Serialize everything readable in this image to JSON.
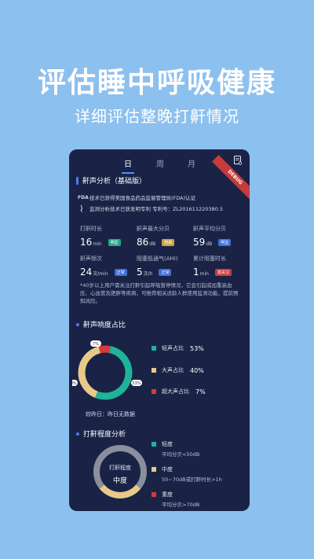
{
  "hero": {
    "title": "评估睡中呼吸健康",
    "subtitle": "详细评估整晚打鼾情况"
  },
  "tabs": [
    "日",
    "周",
    "月"
  ],
  "debug_label": "DEBUG",
  "analysis": {
    "title": "鼾声分析（基础版）",
    "fda_icon": "FDA",
    "fda_text": "技术已获得美国食品药品监督管理局(FDA)认证",
    "patent_text": "监测分析技术已获发明专利 专利号：ZL201611220380.5",
    "metrics": [
      {
        "label": "打鼾时长",
        "value": "16",
        "unit": "min",
        "badge": "明显",
        "badge_color": "#24a58a"
      },
      {
        "label": "鼾声最大分贝",
        "value": "86",
        "unit": "dB",
        "badge": "较高",
        "badge_color": "#c9a24e"
      },
      {
        "label": "鼾声平均分贝",
        "value": "59",
        "unit": "dB",
        "badge": "明显",
        "badge_color": "#3f6fd8"
      },
      {
        "label": "鼾声频次",
        "value": "24",
        "unit": "次/min",
        "badge": "正常",
        "badge_color": "#3f6fd8"
      },
      {
        "label": "阻塞低通气(AHI)",
        "value": "5",
        "unit": "次/h",
        "badge": "正常",
        "badge_color": "#3f6fd8"
      },
      {
        "label": "累计阻塞时长",
        "value": "1",
        "unit": "min",
        "badge": "需关注",
        "badge_color": "#cf3b3b"
      }
    ],
    "note": "*40岁以上用户需关注打鼾引起呼吸暂停情况，它会引起或加重高血压、心血管及肥胖等疾病，可推荐相关适龄人群使用监测功能，提前预知风险。"
  },
  "loudness": {
    "title": "鼾声响度占比",
    "compare": "较昨日：昨日无数据",
    "legend": [
      {
        "label": "轻声占比",
        "pct": "53%",
        "color": "#1fb39a"
      },
      {
        "label": "大声占比",
        "pct": "40%",
        "color": "#e8c987"
      },
      {
        "label": "超大声占比",
        "pct": "7%",
        "color": "#d63a3a"
      }
    ],
    "donut_labels": {
      "light": "53%",
      "loud": "40%",
      "xloud": "7%"
    }
  },
  "chart_data": {
    "type": "pie",
    "title": "鼾声响度占比",
    "categories": [
      "轻声占比",
      "大声占比",
      "超大声占比"
    ],
    "values": [
      53,
      40,
      7
    ]
  },
  "severity": {
    "title": "打鼾程度分析",
    "center_top": "打鼾程度",
    "center_main": "中度",
    "levels": [
      {
        "name": "轻度",
        "desc": "平均分贝<50dB",
        "color": "#1fb39a"
      },
      {
        "name": "中度",
        "desc": "50~70dB或打鼾时长>1h",
        "color": "#e8c987"
      },
      {
        "name": "重度",
        "desc": "平均分贝>70dB",
        "color": "#d63a3a"
      }
    ]
  }
}
